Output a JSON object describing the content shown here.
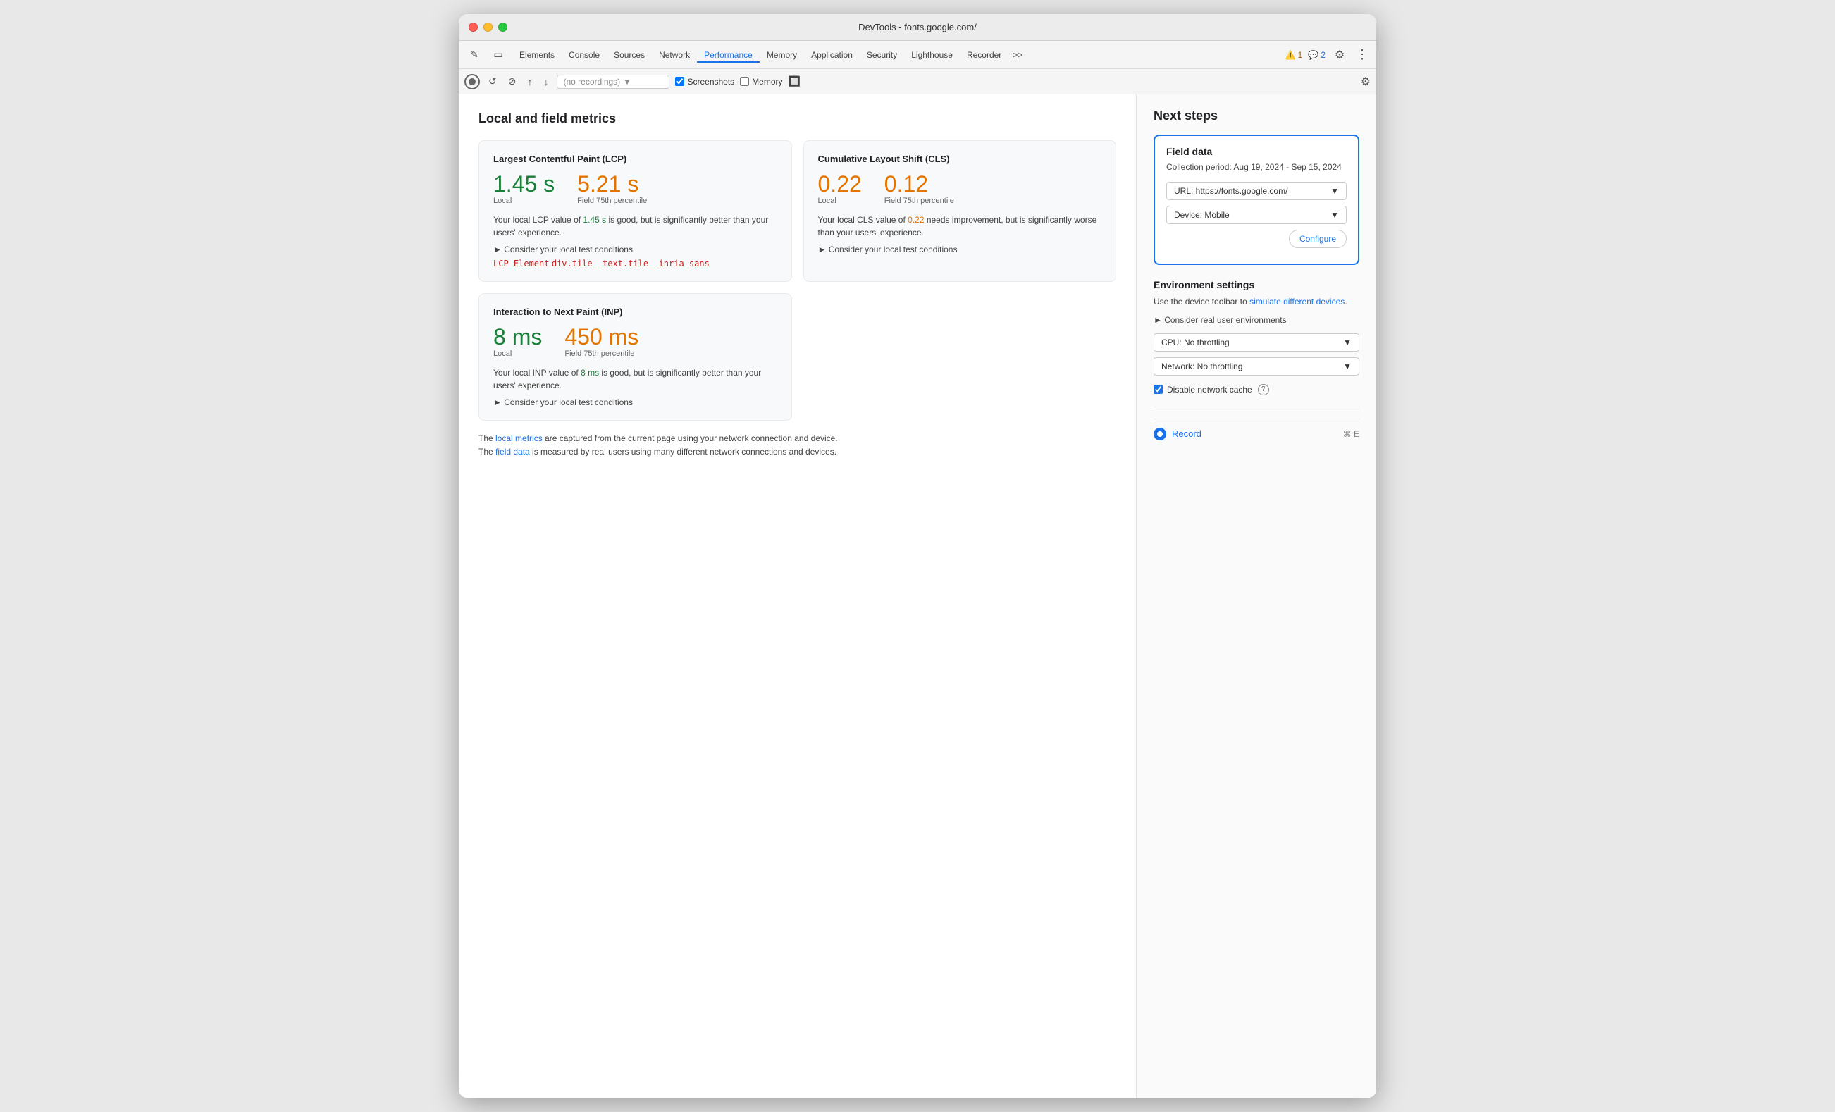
{
  "window": {
    "title": "DevTools - fonts.google.com/"
  },
  "tabs": {
    "items": [
      {
        "label": "Elements",
        "active": false
      },
      {
        "label": "Console",
        "active": false
      },
      {
        "label": "Sources",
        "active": false
      },
      {
        "label": "Network",
        "active": false
      },
      {
        "label": "Performance",
        "active": true
      },
      {
        "label": "Memory",
        "active": false
      },
      {
        "label": "Application",
        "active": false
      },
      {
        "label": "Security",
        "active": false
      },
      {
        "label": "Lighthouse",
        "active": false
      },
      {
        "label": "Recorder",
        "active": false
      }
    ],
    "more_label": ">>",
    "warnings": "1",
    "info": "2"
  },
  "toolbar2": {
    "recording_placeholder": "(no recordings)",
    "screenshots_label": "Screenshots",
    "memory_label": "Memory"
  },
  "main": {
    "section_title": "Local and field metrics"
  },
  "lcp": {
    "title": "Largest Contentful Paint (LCP)",
    "local_value": "1.45 s",
    "field_value": "5.21 s",
    "local_label": "Local",
    "field_label": "Field 75th percentile",
    "description_prefix": "Your local LCP value of ",
    "local_highlight": "1.45 s",
    "description_middle": " is good, but is significantly better than your users' experience.",
    "consider_link": "► Consider your local test conditions",
    "lcp_element_label": "LCP Element",
    "lcp_element_value": "div.tile__text.tile__inria_sans"
  },
  "cls": {
    "title": "Cumulative Layout Shift (CLS)",
    "local_value": "0.22",
    "field_value": "0.12",
    "local_label": "Local",
    "field_label": "Field 75th percentile",
    "description_prefix": "Your local CLS value of ",
    "local_highlight": "0.22",
    "description_middle": " needs improvement, but is significantly worse than your users' experience.",
    "consider_link": "► Consider your local test conditions"
  },
  "inp": {
    "title": "Interaction to Next Paint (INP)",
    "local_value": "8 ms",
    "field_value": "450 ms",
    "local_label": "Local",
    "field_label": "Field 75th percentile",
    "description_prefix": "Your local INP value of ",
    "local_highlight": "8 ms",
    "description_middle": " is good, but is significantly better than your users' experience.",
    "consider_link": "► Consider your local test conditions"
  },
  "footer": {
    "line1_prefix": "The ",
    "line1_link": "local metrics",
    "line1_suffix": " are captured from the current page using your network connection and device.",
    "line2_prefix": "The ",
    "line2_link": "field data",
    "line2_suffix": " is measured by real users using many different network connections and devices."
  },
  "next_steps": {
    "title": "Next steps",
    "field_data": {
      "title": "Field data",
      "collection_period": "Collection period: Aug 19, 2024 - Sep 15, 2024",
      "url_label": "URL: https://fonts.google.com/",
      "device_label": "Device: Mobile",
      "configure_label": "Configure"
    },
    "env_settings": {
      "title": "Environment settings",
      "description": "Use the device toolbar to ",
      "link_text": "simulate different devices",
      "link_suffix": ".",
      "consider_label": "► Consider real user environments",
      "cpu_label": "CPU: No throttling",
      "network_label": "Network: No throttling",
      "disable_cache_label": "Disable network cache"
    },
    "record": {
      "label": "Record",
      "shortcut": "⌘ E"
    }
  }
}
